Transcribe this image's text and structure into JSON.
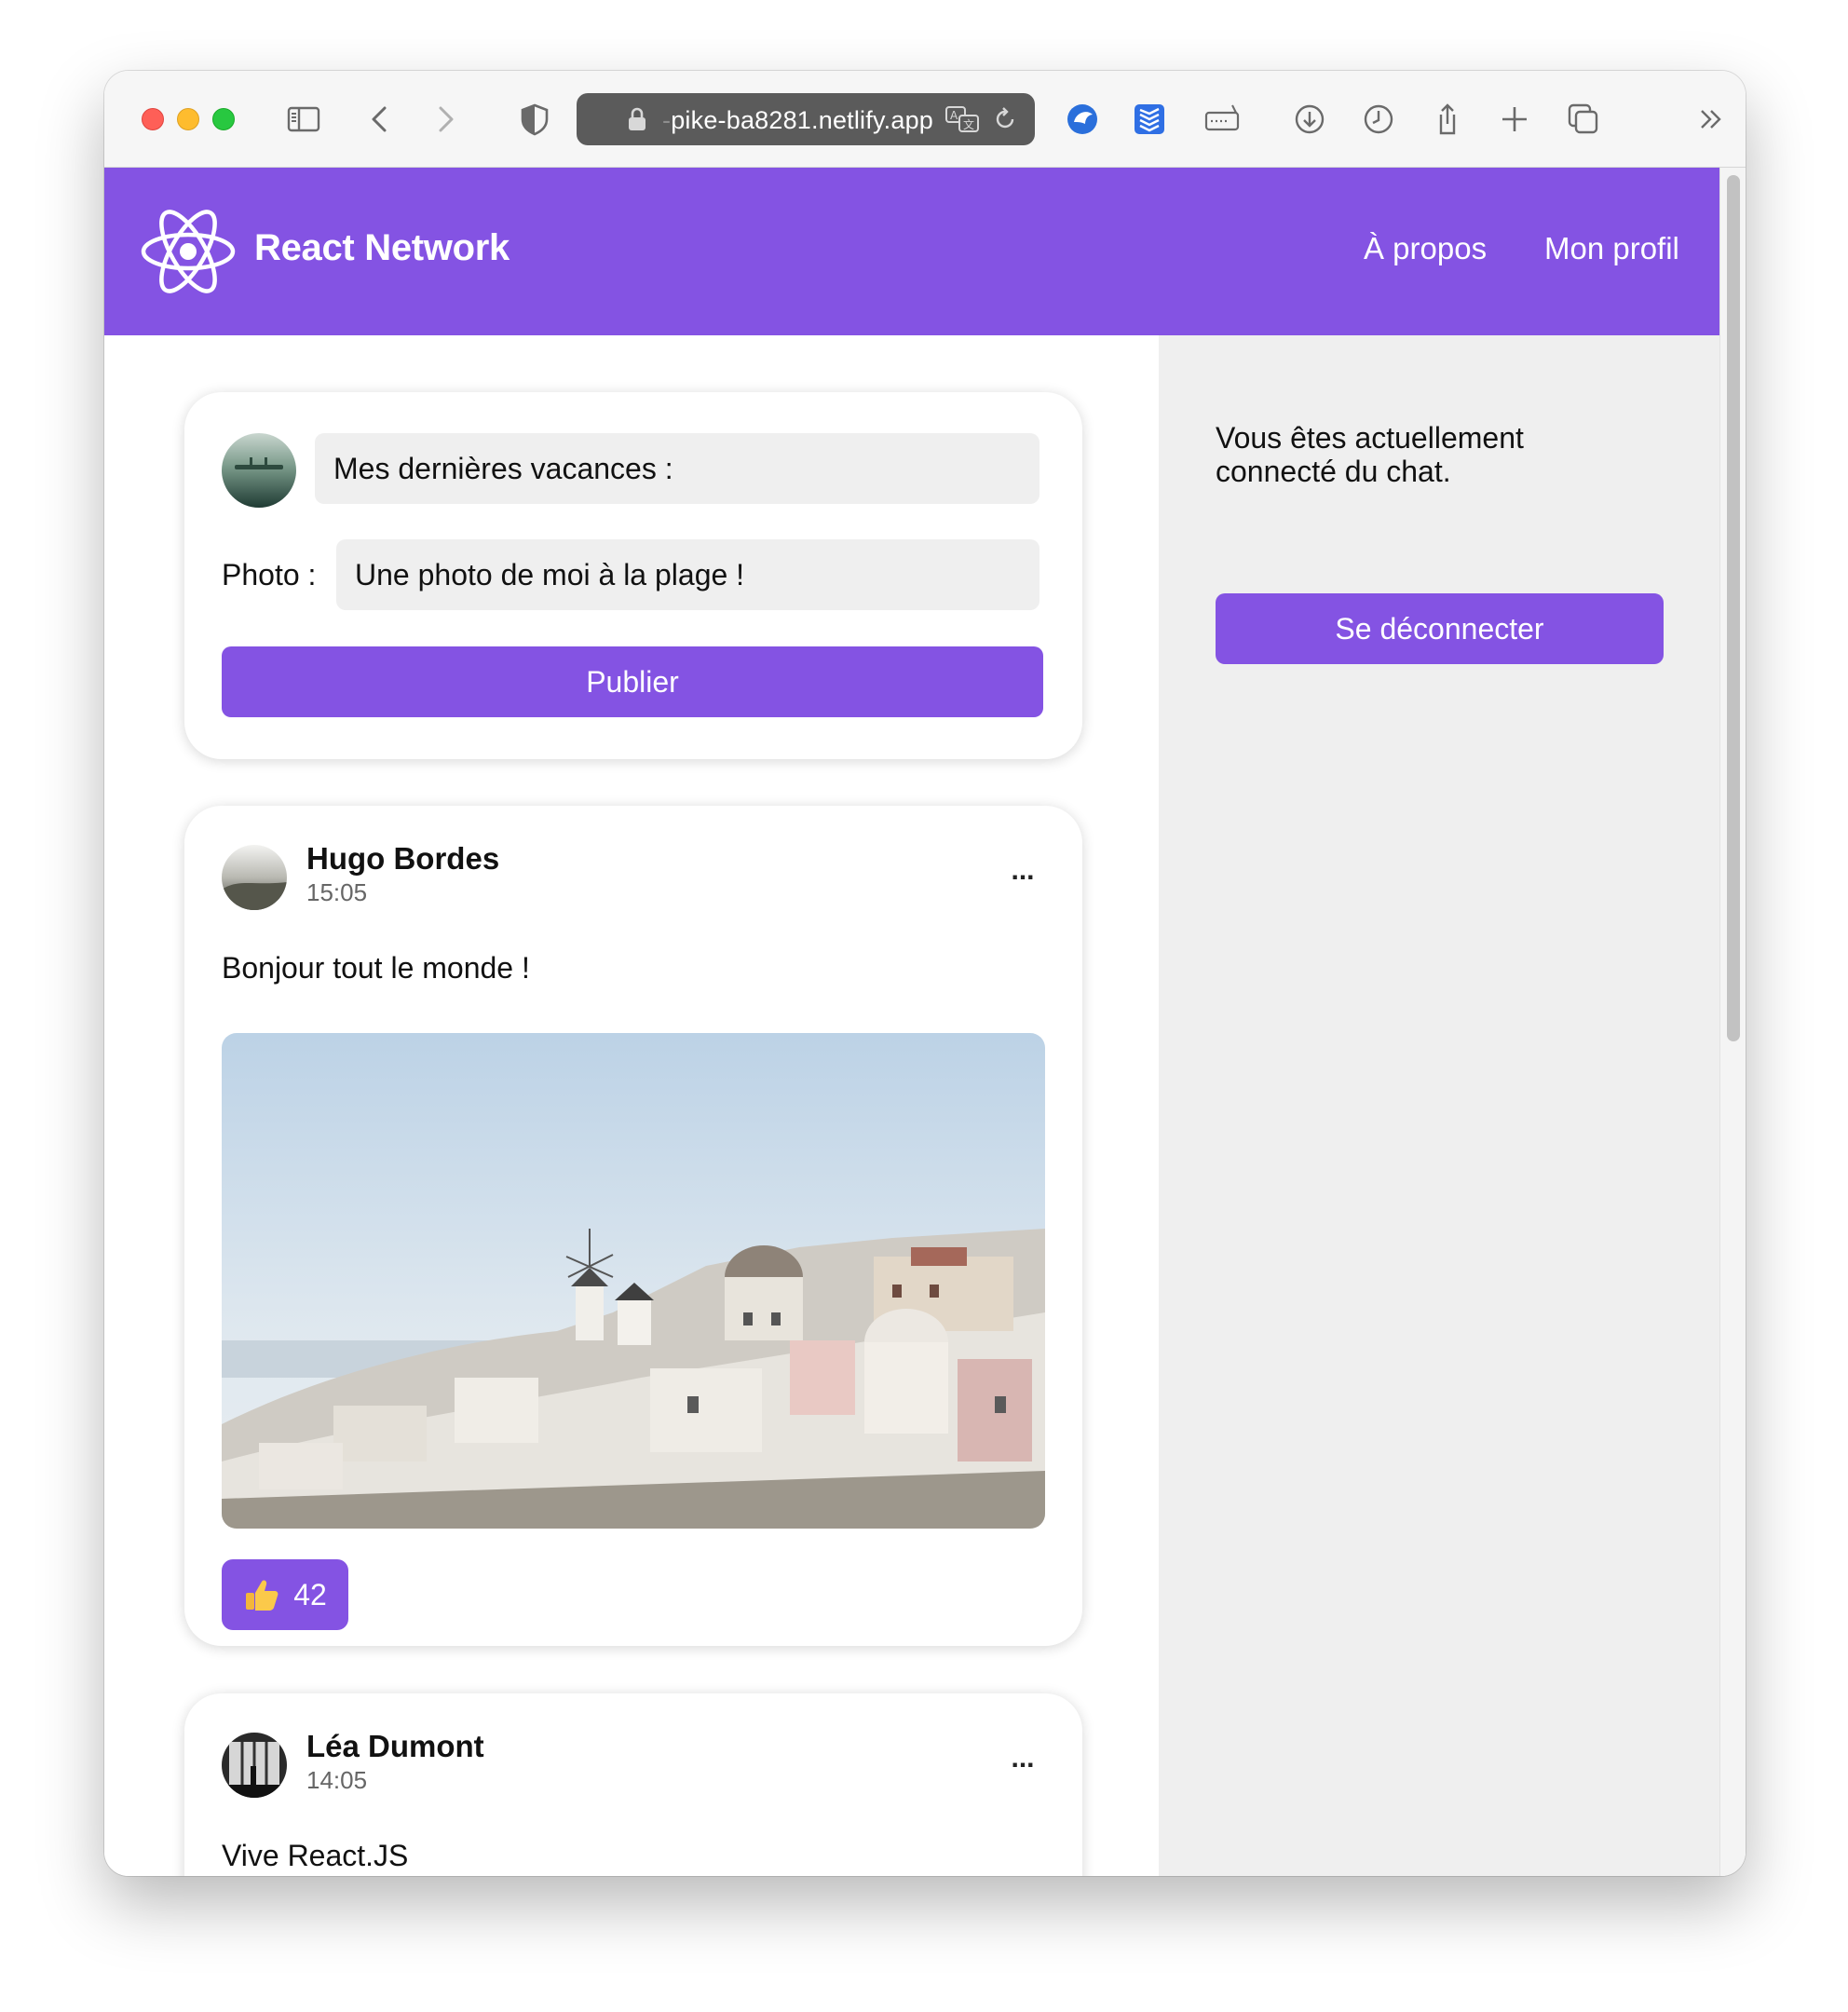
{
  "browser": {
    "url_prefix": "-",
    "url_domain": "pike-ba8281.netlify.app"
  },
  "header": {
    "brand": "React Network",
    "nav": [
      "À propos",
      "Mon profil"
    ],
    "color": "#8453e3"
  },
  "composer": {
    "title_value": "Mes dernières vacances :",
    "photo_label": "Photo :",
    "photo_value": "Une photo de moi à la plage !",
    "publish_label": "Publier"
  },
  "posts": [
    {
      "author": "Hugo Bordes",
      "time": "15:05",
      "text": "Bonjour tout le monde !",
      "likes": "42",
      "more": "..."
    },
    {
      "author": "Léa Dumont",
      "time": "14:05",
      "text": "Vive React.JS",
      "more": "..."
    }
  ],
  "sidebar": {
    "status": "Vous êtes actuellement connecté du chat.",
    "logout_label": "Se déconnecter"
  },
  "icons": {
    "traffic_lights": [
      "close-icon",
      "minimize-icon",
      "zoom-icon"
    ],
    "toolbar": [
      "sidebar-icon",
      "back-icon",
      "forward-icon",
      "shield-icon",
      "lock-icon",
      "translate-icon",
      "reload-icon",
      "extension-icon",
      "stack-icon",
      "keyboard-icon",
      "download-icon",
      "history-icon",
      "share-icon",
      "new-tab-icon",
      "tabs-icon",
      "overflow-icon"
    ],
    "like": "thumbs-up-icon"
  }
}
